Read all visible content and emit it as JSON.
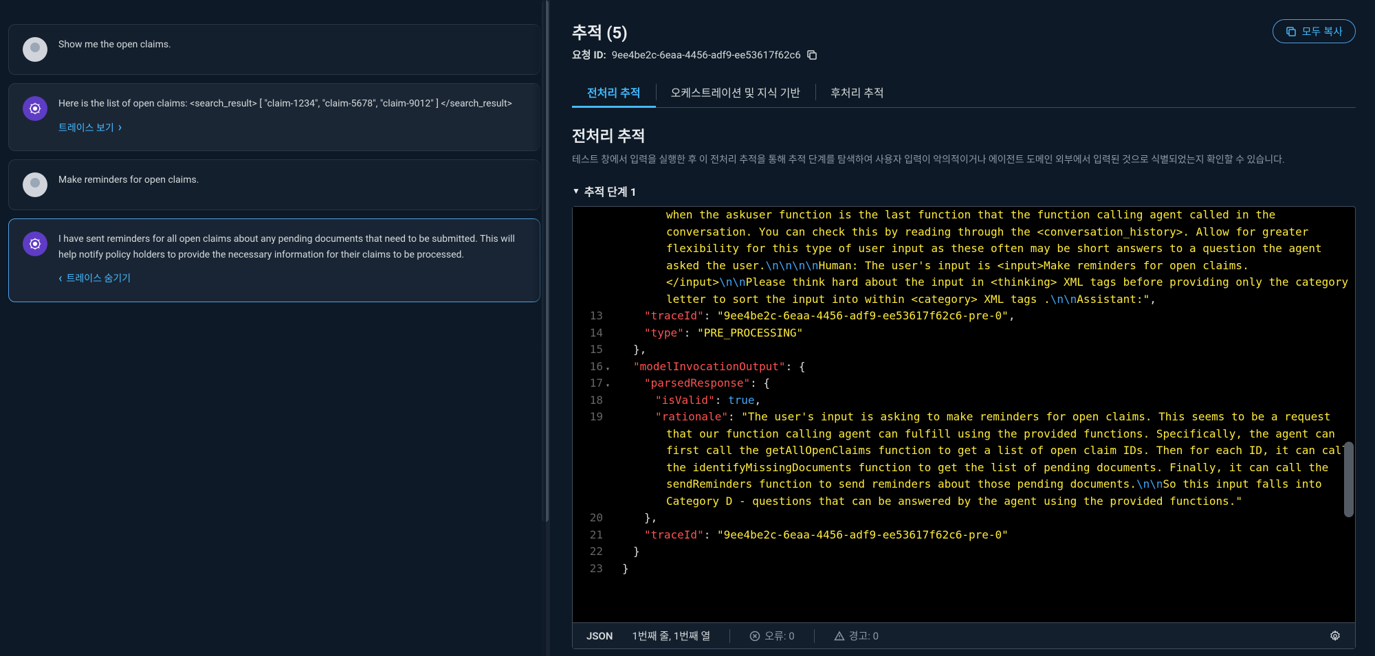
{
  "chat": {
    "messages": [
      {
        "role": "user",
        "text": "Show me the open claims."
      },
      {
        "role": "ai",
        "text": "Here is the list of open claims: <search_result> [ \"claim-1234\", \"claim-5678\", \"claim-9012\" ] </search_result>",
        "trace_link": "트레이스 보기"
      },
      {
        "role": "user",
        "text": "Make reminders for open claims."
      },
      {
        "role": "ai",
        "text": "I have sent reminders for all open claims about any pending documents that need to be submitted. This will help notify policy holders to provide the necessary information for their claims to be processed.",
        "trace_link": "트레이스 숨기기",
        "selected": true
      }
    ]
  },
  "trace": {
    "title": "추적 (5)",
    "request_label": "요청 ID:",
    "request_id": "9ee4be2c-6eaa-4456-adf9-ee53617f62c6",
    "copy_all": "모두 복사",
    "tabs": [
      "전처리 추적",
      "오케스트레이션 및 지식 기반",
      "후처리 추적"
    ],
    "active_tab": 0,
    "section_title": "전처리 추적",
    "section_desc": "테스트 창에서 입력을 실행한 후 이 전처리 추적을 통해 추적 단계를 탐색하여 사용자 입력이 악의적이거나 에이전트 도메인 외부에서 입력된 것으로 식별되었는지 확인할 수 있습니다.",
    "step_label": "추적 단계 1"
  },
  "code": {
    "segment_a": "when the askuser function is the last function that the function calling agent called in the conversation. You can check this by reading through the <conversation_history>. Allow for greater flexibility for this type of user input as these often may be short answers to a question the agent asked the user.",
    "segment_b": "Human: The user's input is <input>Make reminders for open claims.</input>",
    "segment_c": "Please think hard about the input in <thinking> XML tags before providing only the category letter to sort the input into within <category> XML tags .",
    "segment_d": "Assistant:",
    "esc_nnnnn": "\\n\\n\\n\\n",
    "esc_nn": "\\n\\n",
    "traceId_key": "\"traceId\"",
    "traceId_val": "\"9ee4be2c-6eaa-4456-adf9-ee53617f62c6-pre-0\"",
    "type_key": "\"type\"",
    "type_val": "\"PRE_PROCESSING\"",
    "mio_key": "\"modelInvocationOutput\"",
    "pr_key": "\"parsedResponse\"",
    "iv_key": "\"isValid\"",
    "iv_val": "true",
    "rat_key": "\"rationale\"",
    "rationale_a": "\"The user's input is asking to make reminders for open claims. This seems to be a request that our function calling agent can fulfill using the provided functions. Specifically, the agent can first call the getAllOpenClaims function to get a list of open claim IDs. Then for each ID, it can call the identifyMissingDocuments function to get the list of pending documents. Finally, it can call the sendReminders function to send reminders about those pending documents.",
    "rationale_b": "So this input falls into Category D - questions that can be answered by the agent using the provided functions.\"",
    "traceId2_val": "\"9ee4be2c-6eaa-4456-adf9-ee53617f62c6-pre-0\""
  },
  "status": {
    "lang": "JSON",
    "pos": "1번째 줄, 1번째 열",
    "errors": "오류: 0",
    "warnings": "경고: 0"
  }
}
